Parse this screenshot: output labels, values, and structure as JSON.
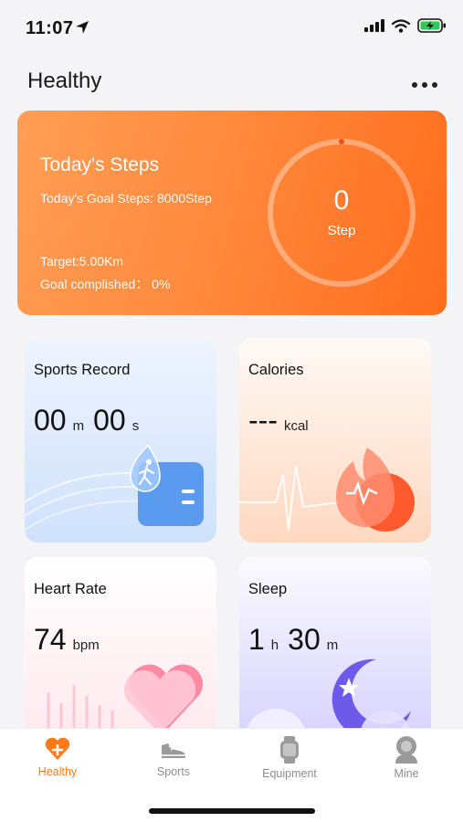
{
  "status_bar": {
    "time": "11:07"
  },
  "header": {
    "title": "Healthy",
    "more_icon": "more-horizontal-icon"
  },
  "steps": {
    "title": "Today's Steps",
    "goal_label": "Today's Goal Steps: 8000Step",
    "target_label": "Target:5.00Km",
    "complete_label": "Goal complished： 0%",
    "count": "0",
    "unit": "Step",
    "progress": 0
  },
  "cards": {
    "sports": {
      "title": "Sports Record",
      "minutes": "00",
      "minutes_unit": "m",
      "seconds": "00",
      "seconds_unit": "s"
    },
    "calories": {
      "title": "Calories",
      "value": "---",
      "unit": "kcal"
    },
    "heart": {
      "title": "Heart Rate",
      "value": "74",
      "unit": "bpm"
    },
    "sleep": {
      "title": "Sleep",
      "hours": "1",
      "hours_unit": "h",
      "minutes": "30",
      "minutes_unit": "m"
    }
  },
  "tabs": [
    {
      "label": "Healthy",
      "icon": "heart-plus-icon",
      "active": true
    },
    {
      "label": "Sports",
      "icon": "sneaker-icon",
      "active": false
    },
    {
      "label": "Equipment",
      "icon": "smartwatch-icon",
      "active": false
    },
    {
      "label": "Mine",
      "icon": "user-icon",
      "active": false
    }
  ],
  "colors": {
    "accent": "#ff7a1a",
    "steps_card": "#ff8a3e"
  }
}
